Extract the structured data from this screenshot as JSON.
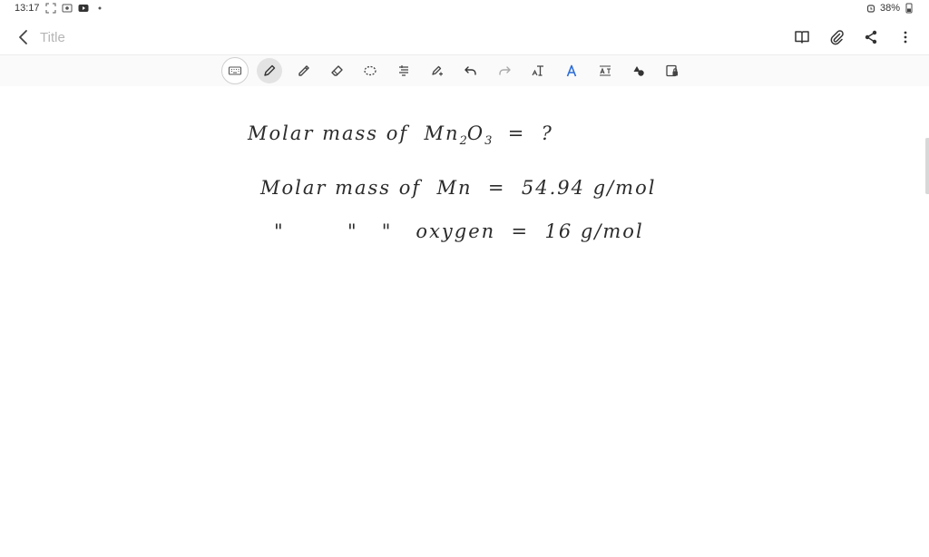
{
  "status_bar": {
    "time": "13:17",
    "battery": "38%"
  },
  "header": {
    "title_placeholder": "Title",
    "title_value": ""
  },
  "toolbar": {
    "tools": [
      "keyboard",
      "pen",
      "highlighter",
      "eraser",
      "lasso",
      "text-format",
      "ruler-pen",
      "undo",
      "redo",
      "text",
      "text-style",
      "insert-text",
      "shapes",
      "lock-image"
    ]
  },
  "note": {
    "line1": {
      "prefix": "Molar mass of  Mn",
      "sub1": "2",
      "mid": "O",
      "sub2": "3",
      "suffix": "  =  ?"
    },
    "line2": "Molar mass of  Mn  =  54.94 g/mol",
    "line3": "\"        \"   \"   oxygen  =  16 g/mol"
  },
  "colors": {
    "ink": "#2b2b2b",
    "placeholder": "#b5b5b5",
    "toolbar_bg": "#fafafa",
    "active_tool": "#e3e3e3"
  }
}
